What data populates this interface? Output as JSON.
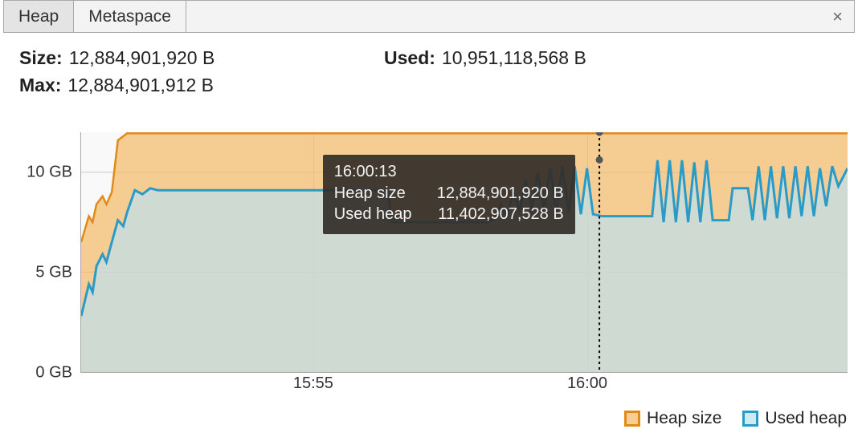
{
  "tabs": {
    "heap": "Heap",
    "metaspace": "Metaspace",
    "close_glyph": "×"
  },
  "stats": {
    "size_label": "Size:",
    "size_value": "12,884,901,920 B",
    "used_label": "Used:",
    "used_value": "10,951,118,568 B",
    "max_label": "Max:",
    "max_value": "12,884,901,912 B"
  },
  "y_ticks": {
    "t0": "0 GB",
    "t5": "5 GB",
    "t10": "10 GB"
  },
  "x_ticks": {
    "t1555": "15:55",
    "t1600": "16:00"
  },
  "tooltip": {
    "time": "16:00:13",
    "row1_label": "Heap size",
    "row1_value": "12,884,901,920 B",
    "row2_label": "Used heap",
    "row2_value": "11,402,907,528 B"
  },
  "legend": {
    "heap": "Heap size",
    "used": "Used heap"
  },
  "chart_data": {
    "type": "area",
    "title": "",
    "xlabel": "",
    "ylabel": "",
    "ylim_gb": [
      0,
      12
    ],
    "x_time_range": [
      "15:50:45",
      "16:04:45"
    ],
    "x_ticks": [
      "15:55",
      "16:00"
    ],
    "y_ticks_gb": [
      0,
      5,
      10
    ],
    "cursor_time": "16:00:13",
    "tooltip_values_bytes": {
      "heap_size": 12884901920,
      "used_heap": 11402907528
    },
    "series": [
      {
        "name": "Heap size",
        "unit": "GB",
        "values": [
          [
            0.0,
            6.5
          ],
          [
            0.01,
            7.8
          ],
          [
            0.015,
            7.5
          ],
          [
            0.02,
            8.4
          ],
          [
            0.028,
            8.8
          ],
          [
            0.033,
            8.4
          ],
          [
            0.04,
            9.0
          ],
          [
            0.048,
            11.6
          ],
          [
            0.06,
            11.95
          ],
          [
            1.0,
            11.95
          ]
        ]
      },
      {
        "name": "Used heap",
        "unit": "GB",
        "values": [
          [
            0.0,
            2.8
          ],
          [
            0.01,
            4.4
          ],
          [
            0.015,
            4.0
          ],
          [
            0.02,
            5.3
          ],
          [
            0.028,
            5.9
          ],
          [
            0.033,
            5.5
          ],
          [
            0.04,
            6.5
          ],
          [
            0.048,
            7.6
          ],
          [
            0.055,
            7.3
          ],
          [
            0.06,
            8.0
          ],
          [
            0.07,
            9.1
          ],
          [
            0.08,
            8.9
          ],
          [
            0.09,
            9.2
          ],
          [
            0.1,
            9.1
          ],
          [
            0.4,
            9.1
          ],
          [
            0.405,
            7.5
          ],
          [
            0.53,
            7.5
          ],
          [
            0.54,
            7.7
          ],
          [
            0.548,
            8.4
          ],
          [
            0.556,
            7.8
          ],
          [
            0.564,
            9.0
          ],
          [
            0.572,
            8.1
          ],
          [
            0.58,
            9.6
          ],
          [
            0.588,
            8.2
          ],
          [
            0.596,
            10.0
          ],
          [
            0.604,
            8.1
          ],
          [
            0.612,
            10.2
          ],
          [
            0.62,
            7.9
          ],
          [
            0.628,
            10.3
          ],
          [
            0.636,
            8.0
          ],
          [
            0.644,
            10.3
          ],
          [
            0.652,
            7.9
          ],
          [
            0.66,
            10.2
          ],
          [
            0.668,
            7.9
          ],
          [
            0.68,
            7.8
          ],
          [
            0.745,
            7.8
          ],
          [
            0.752,
            10.6
          ],
          [
            0.76,
            7.5
          ],
          [
            0.768,
            10.6
          ],
          [
            0.776,
            7.5
          ],
          [
            0.784,
            10.6
          ],
          [
            0.792,
            7.5
          ],
          [
            0.8,
            10.5
          ],
          [
            0.808,
            7.5
          ],
          [
            0.816,
            10.6
          ],
          [
            0.824,
            7.6
          ],
          [
            0.832,
            7.6
          ],
          [
            0.845,
            7.6
          ],
          [
            0.85,
            9.2
          ],
          [
            0.87,
            9.2
          ],
          [
            0.876,
            7.6
          ],
          [
            0.884,
            10.3
          ],
          [
            0.892,
            7.6
          ],
          [
            0.9,
            10.3
          ],
          [
            0.908,
            7.7
          ],
          [
            0.916,
            10.3
          ],
          [
            0.924,
            7.7
          ],
          [
            0.932,
            10.3
          ],
          [
            0.94,
            7.8
          ],
          [
            0.948,
            10.3
          ],
          [
            0.956,
            7.8
          ],
          [
            0.964,
            10.2
          ],
          [
            0.972,
            8.3
          ],
          [
            0.98,
            10.3
          ],
          [
            0.988,
            9.3
          ],
          [
            1.0,
            10.2
          ]
        ]
      }
    ],
    "legend": [
      "Heap size",
      "Used heap"
    ]
  }
}
